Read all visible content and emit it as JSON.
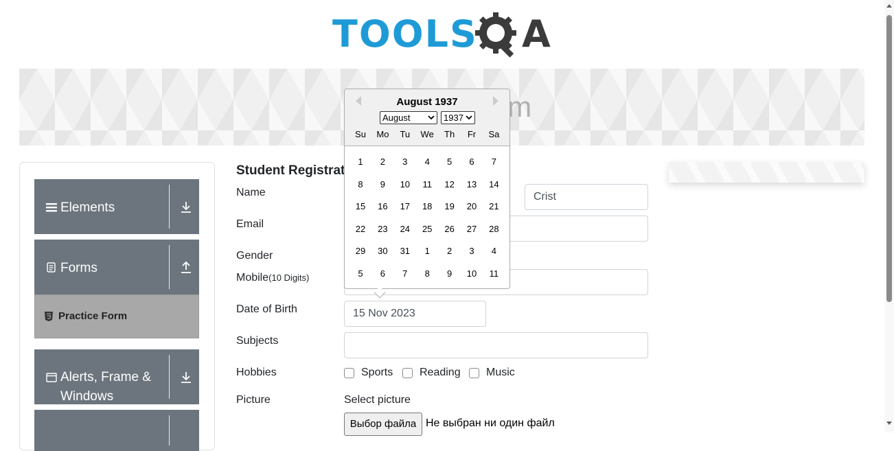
{
  "header": {
    "logo_text": "TOOLS",
    "logo_suffix": "A",
    "banner_title": "Practice Form"
  },
  "sidebar": {
    "groups": [
      {
        "label": "Elements",
        "icon": "hamburger-icon",
        "arrow": "download-arrow-icon"
      },
      {
        "label": "Forms",
        "icon": "document-icon",
        "arrow": "upload-arrow-icon"
      },
      {
        "label": "Alerts, Frame &",
        "label2": "Windows",
        "icon": "window-icon",
        "arrow": "download-arrow-icon"
      }
    ],
    "subitem": {
      "label": "Practice Form",
      "icon": "html5-icon"
    }
  },
  "form": {
    "title": "Student Registration Form",
    "labels": {
      "name": "Name",
      "email": "Email",
      "gender": "Gender",
      "mobile": "Mobile",
      "mobile_hint": "(10 Digits)",
      "dob": "Date of Birth",
      "subjects": "Subjects",
      "hobbies": "Hobbies",
      "picture": "Picture"
    },
    "last_name_value": "Crist",
    "dob_value": "15 Nov 2023",
    "hobbies": [
      "Sports",
      "Reading",
      "Music"
    ],
    "select_picture": "Select picture",
    "file_button": "Выбор файла",
    "file_status": "Не выбран ни один файл"
  },
  "datepicker": {
    "title": "August 1937",
    "month_selected": "August",
    "year_selected": "1937",
    "weekdays": [
      "Su",
      "Mo",
      "Tu",
      "We",
      "Th",
      "Fr",
      "Sa"
    ],
    "weeks": [
      [
        "1",
        "2",
        "3",
        "4",
        "5",
        "6",
        "7"
      ],
      [
        "8",
        "9",
        "10",
        "11",
        "12",
        "13",
        "14"
      ],
      [
        "15",
        "16",
        "17",
        "18",
        "19",
        "20",
        "21"
      ],
      [
        "22",
        "23",
        "24",
        "25",
        "26",
        "27",
        "28"
      ],
      [
        "29",
        "30",
        "31",
        "1",
        "2",
        "3",
        "4"
      ],
      [
        "5",
        "6",
        "7",
        "8",
        "9",
        "10",
        "11"
      ]
    ]
  }
}
